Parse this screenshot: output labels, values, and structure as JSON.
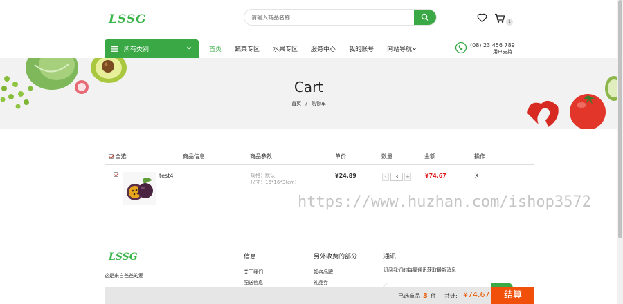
{
  "header": {
    "logo": "LSSG",
    "search_placeholder": "请输入商品名称...",
    "cart_count": "1"
  },
  "nav": {
    "category_label": "所有类别",
    "items": [
      "首页",
      "蔬菜专区",
      "水果专区",
      "服务中心",
      "我的账号",
      "网站导航"
    ],
    "phone": "(08) 23 456 789",
    "phone_label": "用户支持"
  },
  "banner": {
    "title": "Cart",
    "breadcrumb_home": "首页",
    "breadcrumb_sep": "/",
    "breadcrumb_current": "购物车"
  },
  "table": {
    "headers": {
      "select_all": "全选",
      "product": "商品信息",
      "params": "商品参数",
      "price": "单价",
      "qty": "数量",
      "amount": "金额",
      "action": "操作"
    },
    "rows": [
      {
        "name": "test4",
        "spec": "规格：默认",
        "size": "尺寸：16*16*3(cm)",
        "price": "¥24.89",
        "qty": "3",
        "total": "¥74.67",
        "remove": "X"
      }
    ]
  },
  "watermark": "https://www.huzhan.com/ishop3572",
  "footer": {
    "logo": "LSSG",
    "desc": "这是来自爸爸的爱",
    "col1_title": "信息",
    "col1_items": [
      "关于我们",
      "配送信息"
    ],
    "col2_title": "另外收费的部分",
    "col2_items": [
      "知名品牌",
      "礼品券"
    ],
    "col3_title": "通讯",
    "col3_text": "订阅我们的每周通讯获取最新消息"
  },
  "checkout": {
    "selected_prefix": "已选商品",
    "selected_count": "3",
    "selected_suffix": "件",
    "total_label": "共计:",
    "total_amount": "¥74.67",
    "button": "结算"
  },
  "colors": {
    "accent": "#3aa845",
    "price_red": "#e01a1a",
    "checkout_orange": "#f0500a"
  }
}
